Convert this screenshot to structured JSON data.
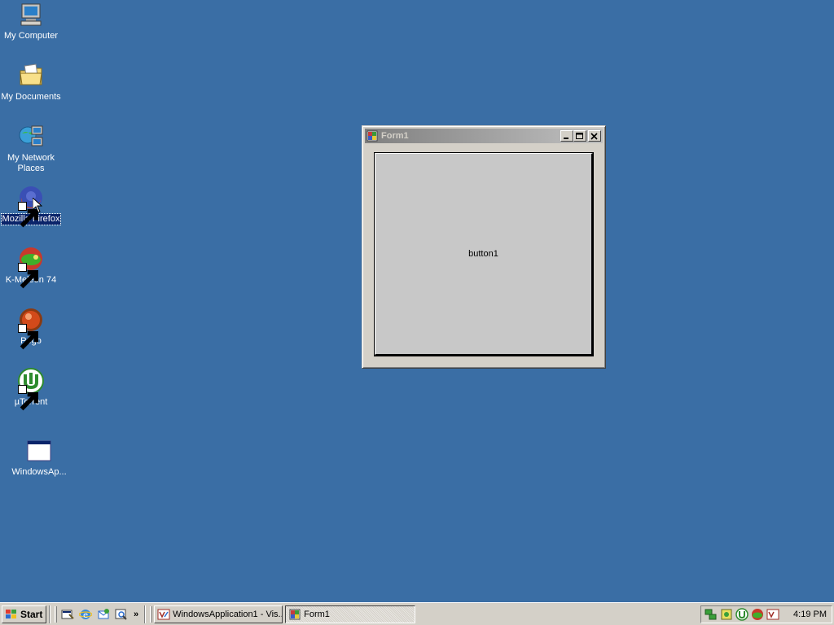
{
  "desktop": {
    "icons": [
      {
        "label": "My Computer",
        "icon": "computer-icon"
      },
      {
        "label": "My Documents",
        "icon": "folder-icon"
      },
      {
        "label": "My Network Places",
        "icon": "network-icon"
      },
      {
        "label": "Mozilla Firefox",
        "icon": "firefox-icon",
        "selected": true
      },
      {
        "label": "K-Meleon 74",
        "icon": "kmeleon-icon"
      },
      {
        "label": "Pego",
        "icon": "pego-icon"
      },
      {
        "label": "µTorrent",
        "icon": "utorrent-icon"
      },
      {
        "label": "WindowsAp...",
        "icon": "application-icon"
      }
    ]
  },
  "window": {
    "title": "Form1",
    "button_label": "button1"
  },
  "taskbar": {
    "start_label": "Start",
    "quicklaunch_overflow": "»",
    "tasks": [
      {
        "label": "WindowsApplication1 - Vis...",
        "icon": "visual-studio-icon",
        "active": false
      },
      {
        "label": "Form1",
        "icon": "form-icon",
        "active": true
      }
    ],
    "clock": "4:19 PM"
  },
  "colors": {
    "desktop": "#3a6ea5",
    "face": "#d4d0c8",
    "selection": "#0a246a"
  }
}
